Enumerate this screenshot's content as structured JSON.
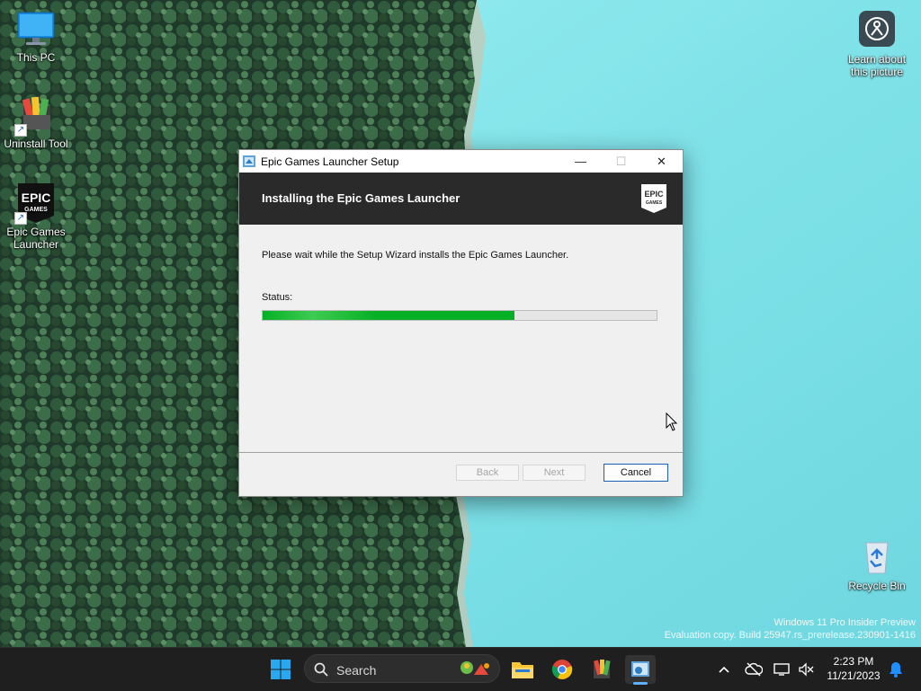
{
  "desktop": {
    "icons": [
      {
        "label": "This PC"
      },
      {
        "label": "Uninstall Tool"
      },
      {
        "label": "Epic Games Launcher",
        "logo_text_top": "EPIC",
        "logo_text_bottom": "GAMES"
      },
      {
        "label": "Recycle Bin"
      }
    ],
    "learn_about": {
      "label_line1": "Learn about",
      "label_line2": "this picture"
    },
    "watermark": {
      "line1": "Windows 11 Pro Insider Preview",
      "line2": "Evaluation copy. Build 25947.rs_prerelease.230901-1416"
    }
  },
  "setup_window": {
    "title": "Epic Games Launcher Setup",
    "header_title": "Installing the Epic Games Launcher",
    "logo": {
      "top": "EPIC",
      "bottom": "GAMES"
    },
    "description": "Please wait while the Setup Wizard installs the Epic Games Launcher.",
    "status_label": "Status:",
    "progress_fraction": 0.64,
    "buttons": {
      "back": "Back",
      "next": "Next",
      "cancel": "Cancel"
    },
    "caption": {
      "minimize": "—",
      "maximize": "☐",
      "close": "✕"
    }
  },
  "taskbar": {
    "search_placeholder": "Search",
    "clock": {
      "time": "2:23 PM",
      "date": "11/21/2023"
    }
  },
  "colors": {
    "progress_green": "#06b025",
    "header_dark": "#2a2a2a",
    "cancel_border": "#1d5fb8",
    "lake": "#86e6ea"
  }
}
